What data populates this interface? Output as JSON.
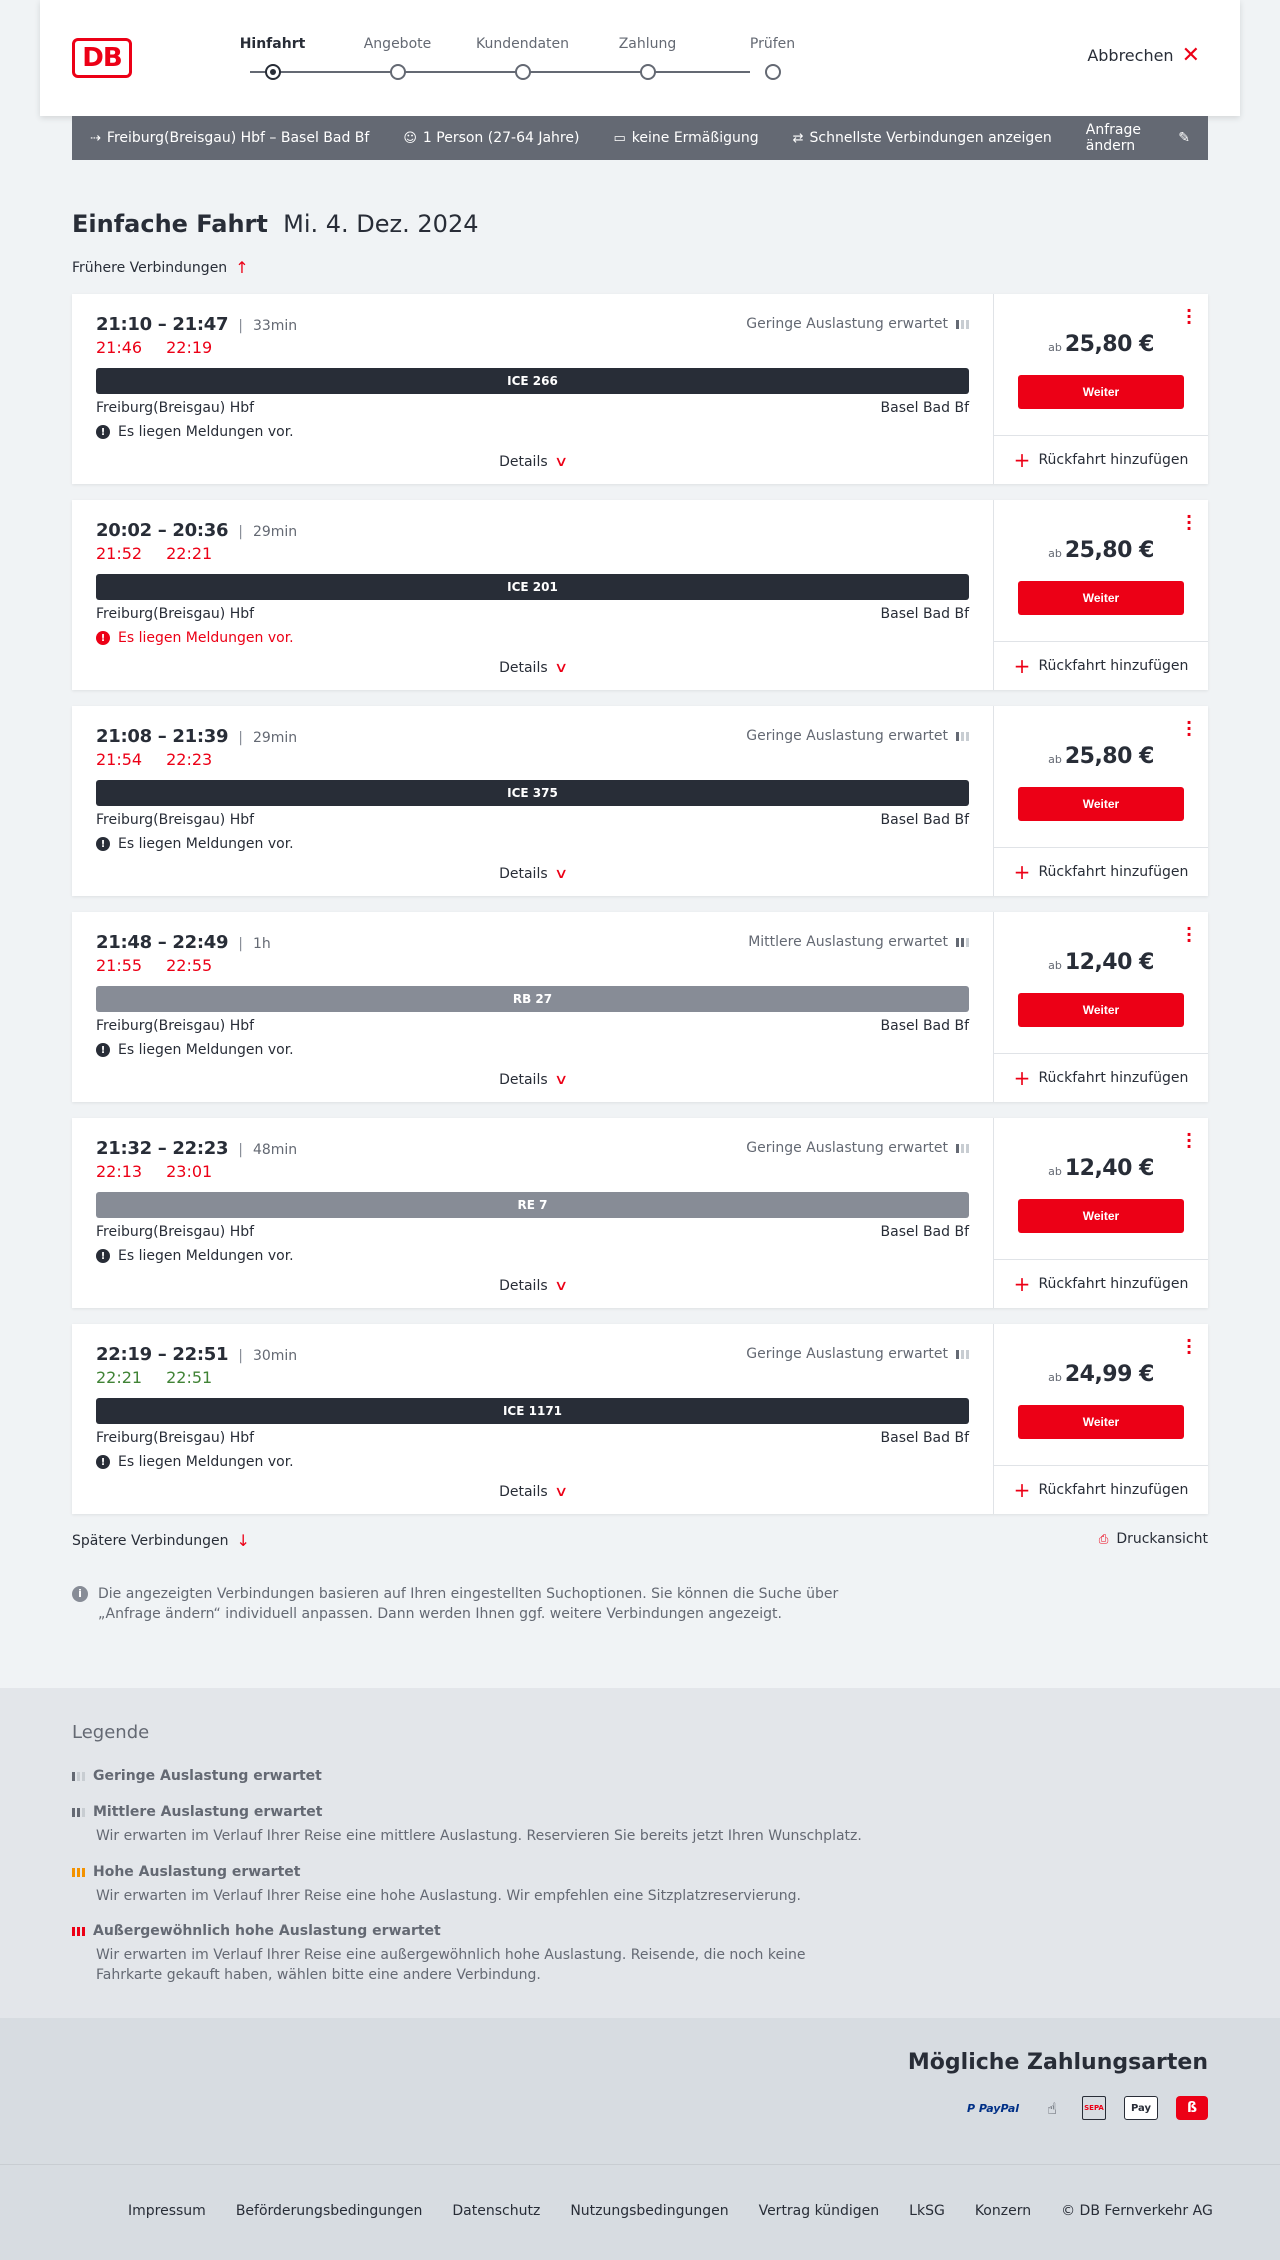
{
  "header": {
    "logo": "DB",
    "steps": [
      {
        "label": "Hinfahrt",
        "active": true
      },
      {
        "label": "Angebote",
        "active": false
      },
      {
        "label": "Kundendaten",
        "active": false
      },
      {
        "label": "Zahlung",
        "active": false
      },
      {
        "label": "Prüfen",
        "active": false
      }
    ],
    "abort_label": "Abbrechen"
  },
  "query": {
    "route": "Freiburg(Breisgau) Hbf – Basel Bad Bf",
    "travellers": "1 Person (27-64 Jahre)",
    "discount": "keine Ermäßigung",
    "fastest": "Schnellste Verbindungen anzeigen",
    "edit": "Anfrage ändern"
  },
  "page": {
    "title_bold": "Einfache Fahrt",
    "title_date": "Mi. 4. Dez. 2024",
    "earlier": "Frühere Verbindungen",
    "later": "Spätere Verbindungen",
    "print": "Druckansicht",
    "info": "Die angezeigten Verbindungen basieren auf Ihren eingestellten Suchoptionen. Sie können die Suche über „Anfrage ändern“ individuell anpassen. Dann werden Ihnen ggf. weitere Verbindungen angezeigt."
  },
  "connections": [
    {
      "planned": "21:10 – 21:47",
      "duration": "33min",
      "occupancy": "Geringe Auslastung erwartet",
      "rt_dep": "21:46",
      "rt_arr": "22:19",
      "rt_state": "late",
      "train": "ICE 266",
      "train_style": "dark",
      "from": "Freiburg(Breisgau) Hbf",
      "to": "Basel Bad Bf",
      "message": "Es liegen Meldungen vor.",
      "msg_style": "normal",
      "details": "Details",
      "price_prefix": "ab",
      "price": "25,80 €",
      "button": "Weiter",
      "return": "Rückfahrt hinzufügen"
    },
    {
      "planned": "20:02 – 20:36",
      "duration": "29min",
      "occupancy": "",
      "rt_dep": "21:52",
      "rt_arr": "22:21",
      "rt_state": "late",
      "train": "ICE 201",
      "train_style": "dark",
      "from": "Freiburg(Breisgau) Hbf",
      "to": "Basel Bad Bf",
      "message": "Es liegen Meldungen vor.",
      "msg_style": "warn",
      "details": "Details",
      "price_prefix": "ab",
      "price": "25,80 €",
      "button": "Weiter",
      "return": "Rückfahrt hinzufügen"
    },
    {
      "planned": "21:08 – 21:39",
      "duration": "29min",
      "occupancy": "Geringe Auslastung erwartet",
      "rt_dep": "21:54",
      "rt_arr": "22:23",
      "rt_state": "late",
      "train": "ICE 375",
      "train_style": "dark",
      "from": "Freiburg(Breisgau) Hbf",
      "to": "Basel Bad Bf",
      "message": "Es liegen Meldungen vor.",
      "msg_style": "normal",
      "details": "Details",
      "price_prefix": "ab",
      "price": "25,80 €",
      "button": "Weiter",
      "return": "Rückfahrt hinzufügen"
    },
    {
      "planned": "21:48 – 22:49",
      "duration": "1h",
      "occupancy": "Mittlere Auslastung erwartet",
      "rt_dep": "21:55",
      "rt_arr": "22:55",
      "rt_state": "late",
      "train": "RB 27",
      "train_style": "grey",
      "from": "Freiburg(Breisgau) Hbf",
      "to": "Basel Bad Bf",
      "message": "Es liegen Meldungen vor.",
      "msg_style": "normal",
      "details": "Details",
      "price_prefix": "ab",
      "price": "12,40 €",
      "button": "Weiter",
      "return": "Rückfahrt hinzufügen"
    },
    {
      "planned": "21:32 – 22:23",
      "duration": "48min",
      "occupancy": "Geringe Auslastung erwartet",
      "rt_dep": "22:13",
      "rt_arr": "23:01",
      "rt_state": "late",
      "train": "RE 7",
      "train_style": "grey",
      "from": "Freiburg(Breisgau) Hbf",
      "to": "Basel Bad Bf",
      "message": "Es liegen Meldungen vor.",
      "msg_style": "normal",
      "details": "Details",
      "price_prefix": "ab",
      "price": "12,40 €",
      "button": "Weiter",
      "return": "Rückfahrt hinzufügen"
    },
    {
      "planned": "22:19 – 22:51",
      "duration": "30min",
      "occupancy": "Geringe Auslastung erwartet",
      "rt_dep": "22:21",
      "rt_arr": "22:51",
      "rt_state": "ontime",
      "train": "ICE 1171",
      "train_style": "dark",
      "from": "Freiburg(Breisgau) Hbf",
      "to": "Basel Bad Bf",
      "message": "Es liegen Meldungen vor.",
      "msg_style": "normal",
      "details": "Details",
      "price_prefix": "ab",
      "price": "24,99 €",
      "button": "Weiter",
      "return": "Rückfahrt hinzufügen"
    }
  ],
  "legend": {
    "title": "Legende",
    "items": [
      {
        "title": "Geringe Auslastung erwartet",
        "desc": ""
      },
      {
        "title": "Mittlere Auslastung erwartet",
        "desc": "Wir erwarten im Verlauf Ihrer Reise eine mittlere Auslastung. Reservieren Sie bereits jetzt Ihren Wunschplatz."
      },
      {
        "title": "Hohe Auslastung erwartet",
        "desc": "Wir erwarten im Verlauf Ihrer Reise eine hohe Auslastung. Wir empfehlen eine Sitzplatzreservierung."
      },
      {
        "title": "Außergewöhnlich hohe Auslastung erwartet",
        "desc": "Wir erwarten im Verlauf Ihrer Reise eine außergewöhnlich hohe Auslastung. Reisende, die noch keine Fahrkarte gekauft haben, wählen bitte eine andere Verbindung."
      }
    ]
  },
  "payment": {
    "title": "Mögliche Zahlungsarten",
    "paypal": "P PayPal",
    "sepa": "SEPA",
    "apple_pay": " Pay"
  },
  "footer": {
    "links": [
      "Impressum",
      "Beförderungsbedingungen",
      "Datenschutz",
      "Nutzungsbedingungen",
      "Vertrag kündigen",
      "LkSG",
      "Konzern",
      "© DB Fernverkehr AG"
    ]
  },
  "colors": {
    "accent": "#ec0016",
    "dark": "#282d37",
    "grey": "#646973",
    "ontime": "#408335"
  }
}
